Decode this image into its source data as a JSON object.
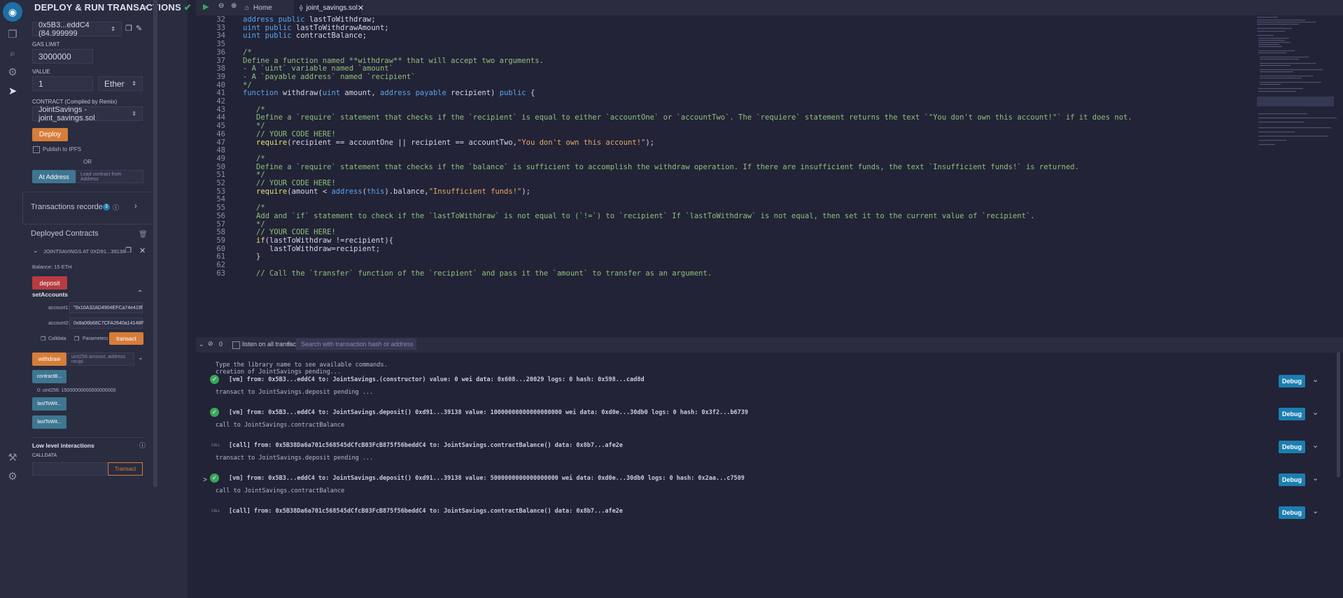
{
  "side_panel": {
    "title": "DEPLOY & RUN TRANSACTIONS",
    "account": "0x5B3...eddC4 (84.999999",
    "gas_limit_label": "GAS LIMIT",
    "gas_limit": "3000000",
    "value_label": "VALUE",
    "value": "1",
    "value_unit": "Ether",
    "contract_label": "CONTRACT (Compiled by Remix)",
    "contract": "JointSavings - joint_savings.sol",
    "deploy": "Deploy",
    "publish_ipfs": "Publish to IPFS",
    "or": "OR",
    "at_address": "At Address",
    "load_address": "Load contract from Address",
    "tx_recorded": "Transactions recorded",
    "tx_count": "3",
    "deployed_title": "Deployed Contracts",
    "instance": "JOINTSAVINGS AT 0XD91...39138",
    "balance": "Balance: 15 ETH",
    "deposit": "deposit",
    "set_accounts": "setAccounts",
    "account1_label": "account1:",
    "account1": "\"0x10A32AD4904EFCa74e419f",
    "account2_label": "account2:",
    "account2": "0x8a06b68C7CFA2640a14148F",
    "calldata": "Calldata",
    "parameters": "Parameters",
    "transact": "transact",
    "withdraw": "withdraw",
    "withdraw_params": "uint256 amount, address recipi",
    "contract_balance": "contractB...",
    "contract_balance_result": "0: uint256: 15000000000000000000",
    "last_to_wit_1": "lastToWit...",
    "last_to_wit_2": "lastToWit...",
    "low_level": "Low level interactions",
    "calldata_label": "CALLDATA",
    "transact2": "Transact"
  },
  "tabs": {
    "home": "Home",
    "file": "joint_savings.sol"
  },
  "code": [
    {
      "n": "32",
      "t": "<span class='kw'>address public</span> lastToWithdraw;",
      "i": 0
    },
    {
      "n": "33",
      "t": "<span class='kw'>uint public</span> lastToWithdrawAmount;",
      "i": 0
    },
    {
      "n": "34",
      "t": "<span class='kw'>uint public</span> contractBalance;",
      "i": 0
    },
    {
      "n": "35",
      "t": "",
      "i": 0
    },
    {
      "n": "36",
      "t": "<span class='cm'>/*</span>",
      "i": 0
    },
    {
      "n": "37",
      "t": "<span class='cm'>Define a function named **withdraw** that will accept two arguments.</span>",
      "i": 0
    },
    {
      "n": "38",
      "t": "<span class='cm'>- A `uint` variable named `amount`</span>",
      "i": 0
    },
    {
      "n": "39",
      "t": "<span class='cm'>- A `payable address` named `recipient`</span>",
      "i": 0
    },
    {
      "n": "40",
      "t": "<span class='cm'>*/</span>",
      "i": 0
    },
    {
      "n": "41",
      "t": "<span class='kw'>function</span> withdraw(<span class='kw'>uint</span> amount, <span class='kw'>address payable</span> recipient) <span class='kw'>public</span> {",
      "i": 0
    },
    {
      "n": "42",
      "t": "",
      "i": 0
    },
    {
      "n": "43",
      "t": "<span class='cm'>/*</span>",
      "i": 1
    },
    {
      "n": "44",
      "t": "<span class='cm'>Define a `require` statement that checks if the `recipient` is equal to either `accountOne` or `accountTwo`. The `requiere` statement returns the text `\"You don't own this account!\"` if it does not.</span>",
      "i": 1
    },
    {
      "n": "45",
      "t": "<span class='cm'>*/</span>",
      "i": 1
    },
    {
      "n": "46",
      "t": "<span class='cm'>// YOUR CODE HERE!</span>",
      "i": 1
    },
    {
      "n": "47",
      "t": "<span class='fn'>require</span>(recipient == accountOne || recipient == accountTwo,<span class='st'>\"You don't own this account!\"</span>);",
      "i": 1
    },
    {
      "n": "48",
      "t": "",
      "i": 1
    },
    {
      "n": "49",
      "t": "<span class='cm'>/*</span>",
      "i": 1
    },
    {
      "n": "50",
      "t": "<span class='cm'>Define a `require` statement that checks if the `balance` is sufficient to accomplish the withdraw operation. If there are insufficient funds, the text `Insufficient funds!` is returned.</span>",
      "i": 1
    },
    {
      "n": "51",
      "t": "<span class='cm'>*/</span>",
      "i": 1
    },
    {
      "n": "52",
      "t": "<span class='cm'>// YOUR CODE HERE!</span>",
      "i": 1
    },
    {
      "n": "53",
      "t": "<span class='fn'>require</span>(amount &lt; <span class='kw'>address</span>(<span class='kw'>this</span>).balance,<span class='st'>\"Insufficient funds!\"</span>);",
      "i": 1
    },
    {
      "n": "54",
      "t": "",
      "i": 1
    },
    {
      "n": "55",
      "t": "<span class='cm'>/*</span>",
      "i": 1
    },
    {
      "n": "56",
      "t": "<span class='cm'>Add and `if` statement to check if the `lastToWithdraw` is not equal to (`!=`) to `recipient` If `lastToWithdraw` is not equal, then set it to the current value of `recipient`.</span>",
      "i": 1
    },
    {
      "n": "57",
      "t": "<span class='cm'>*/</span>",
      "i": 1
    },
    {
      "n": "58",
      "t": "<span class='cm'>// YOUR CODE HERE!</span>",
      "i": 1
    },
    {
      "n": "59",
      "t": "<span class='fn'>if</span>(lastToWithdraw !=recipient){",
      "i": 1
    },
    {
      "n": "60",
      "t": "lastToWithdraw=recipient;",
      "i": 2
    },
    {
      "n": "61",
      "t": "}",
      "i": 1
    },
    {
      "n": "62",
      "t": "",
      "i": 1
    },
    {
      "n": "63",
      "t": "<span class='cm'>// Call the `transfer` function of the `recipient` and pass it the `amount` to transfer as an argument.</span>",
      "i": 1
    }
  ],
  "terminal": {
    "count": "0",
    "listen_label": "listen on all transactions",
    "search_placeholder": "Search with transaction hash or address",
    "intro1": "Type the library name to see available commands.",
    "intro2": "creation of JointSavings pending...",
    "entries": [
      {
        "kind": "vm",
        "text": "[vm]  from: 0x5B3...eddC4 to: JointSavings.(constructor) value: 0 wei data: 0x608...20029 logs: 0 hash: 0x598...cad8d",
        "after": "transact to JointSavings.deposit pending ..."
      },
      {
        "kind": "vm",
        "text": "[vm]  from: 0x5B3...eddC4 to: JointSavings.deposit() 0xd91...39138 value: 10000000000000000000 wei data: 0xd0e...30db0 logs: 0 hash: 0x3f2...b6739",
        "after": "call to JointSavings.contractBalance"
      },
      {
        "kind": "call",
        "text": "[call]  from: 0x5B38Da6a701c568545dCfcB03FcB875f56beddC4 to: JointSavings.contractBalance() data: 0x8b7...afe2e",
        "after": "transact to JointSavings.deposit pending ..."
      },
      {
        "kind": "vm",
        "text": "[vm]  from: 0x5B3...eddC4 to: JointSavings.deposit() 0xd91...39138 value: 5000000000000000000 wei data: 0xd0e...30db0 logs: 0 hash: 0x2aa...c7509",
        "after": "call to JointSavings.contractBalance"
      },
      {
        "kind": "call",
        "text": "[call]  from: 0x5B38Da6a701c568545dCfcB03FcB875f56beddC4 to: JointSavings.contractBalance() data: 0x8b7...afe2e",
        "after": ""
      }
    ],
    "debug": "Debug",
    "call_badge": "CALL",
    "prompt": ">"
  }
}
